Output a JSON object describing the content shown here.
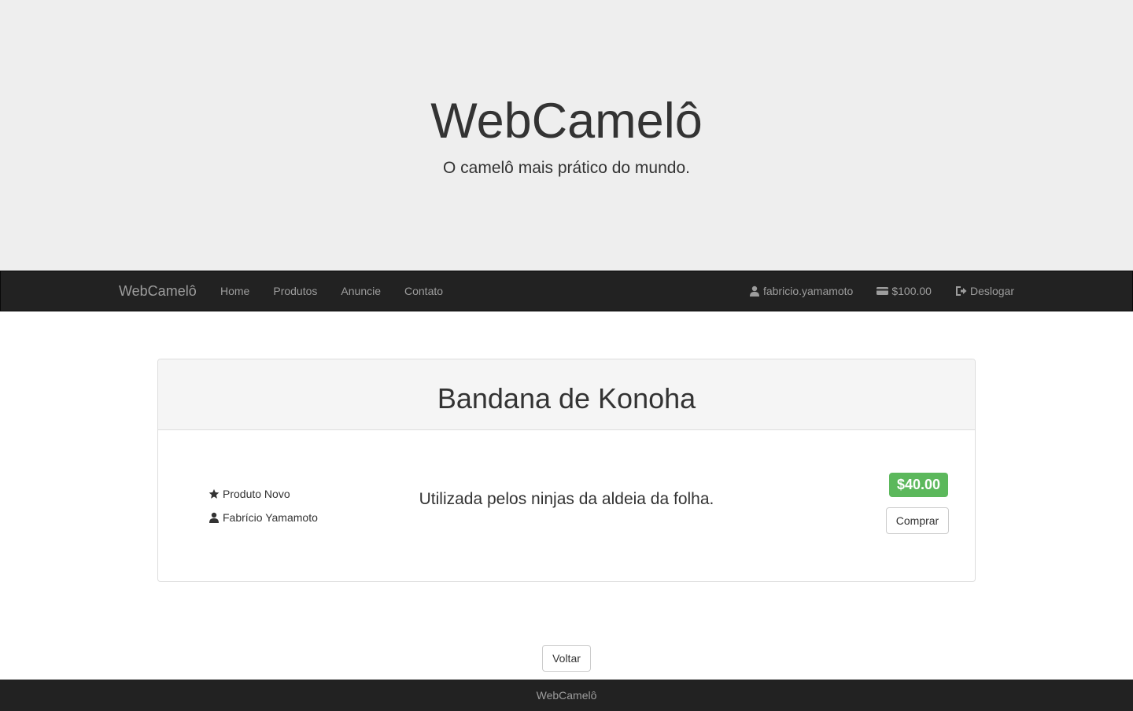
{
  "jumbotron": {
    "title": "WebCamelô",
    "subtitle": "O camelô mais prático do mundo."
  },
  "navbar": {
    "brand": "WebCamelô",
    "links": [
      "Home",
      "Produtos",
      "Anuncie",
      "Contato"
    ],
    "user": "fabricio.yamamoto",
    "balance": "$100.00",
    "logout": "Deslogar"
  },
  "product": {
    "title": "Bandana de Konoha",
    "condition": "Produto Novo",
    "seller": "Fabrício Yamamoto",
    "description": "Utilizada pelos ninjas da aldeia da folha.",
    "price": "$40.00",
    "buy_label": "Comprar"
  },
  "actions": {
    "back_label": "Voltar"
  },
  "footer": {
    "text": "WebCamelô"
  },
  "colors": {
    "navbar_bg": "#222222",
    "jumbotron_bg": "#eeeeee",
    "price_badge": "#5cb85c"
  }
}
